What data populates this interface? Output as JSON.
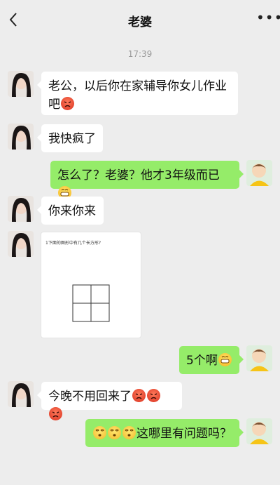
{
  "header": {
    "title": "老婆"
  },
  "timestamp": "17:39",
  "messages": [
    {
      "side": "left",
      "text": "老公，以后你在家辅导你女儿作业",
      "text2": "吧"
    },
    {
      "side": "left",
      "text": "我快疯了"
    },
    {
      "side": "right",
      "text": "怎么了？老婆？他才3年级而已"
    },
    {
      "side": "left",
      "text": "你来你来"
    },
    {
      "side": "left",
      "image_question": "1下面的图形中有几个长方形?"
    },
    {
      "side": "right",
      "text": "5个啊"
    },
    {
      "side": "left",
      "text": "今晚不用回来了"
    },
    {
      "side": "right",
      "text": "这哪里有问题吗？"
    }
  ],
  "colors": {
    "background": "#ededed",
    "self_bubble": "#95ec69",
    "other_bubble": "#ffffff"
  },
  "icons": [
    "back-arrow-icon",
    "more-dots-icon"
  ]
}
